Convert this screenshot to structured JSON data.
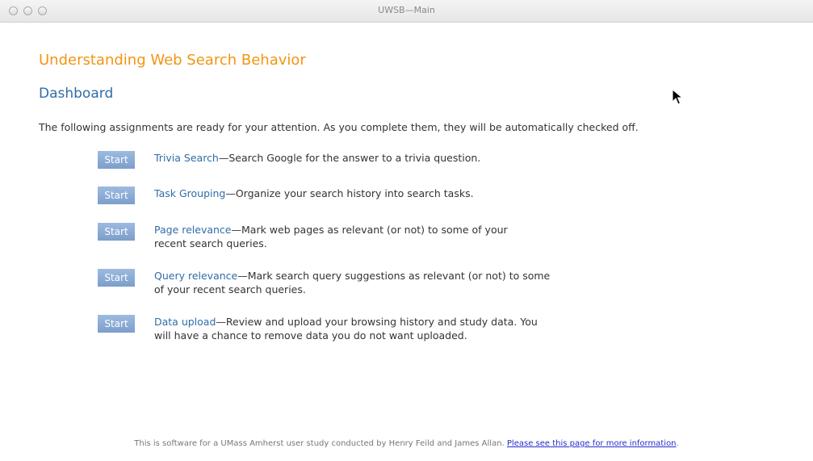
{
  "window": {
    "title": "UWSB—Main"
  },
  "app_title": "Understanding Web Search Behavior",
  "section_title": "Dashboard",
  "intro": "The following assignments are ready for your attention. As you complete them, they will be automatically checked off.",
  "tasks": [
    {
      "button_label": "Start",
      "name": "Trivia Search",
      "separator": "—",
      "description": "Search Google for the answer to a trivia question."
    },
    {
      "button_label": "Start",
      "name": "Task Grouping",
      "separator": "—",
      "description": "Organize your search history into search tasks."
    },
    {
      "button_label": "Start",
      "name": "Page relevance",
      "separator": "—",
      "description": "Mark web pages as relevant (or not) to some of your recent search queries."
    },
    {
      "button_label": "Start",
      "name": "Query relevance",
      "separator": "—",
      "description": "Mark search query suggestions as relevant (or not) to some of your recent search queries."
    },
    {
      "button_label": "Start",
      "name": "Data upload",
      "separator": "—",
      "description": "Review and upload your browsing history and study data. You will have a chance to remove data you do not want uploaded."
    }
  ],
  "footer": {
    "text": "This is software for a UMass Amherst user study conducted by Henry Feild and James Allan. ",
    "link_text": "Please see this page for more information",
    "end": "."
  },
  "colors": {
    "app_title": "#f39512",
    "section_title": "#2f6da7",
    "button": "#8aa9d4",
    "link": "#2a2acc"
  },
  "icons": {
    "cursor": "mouse-pointer-icon"
  }
}
